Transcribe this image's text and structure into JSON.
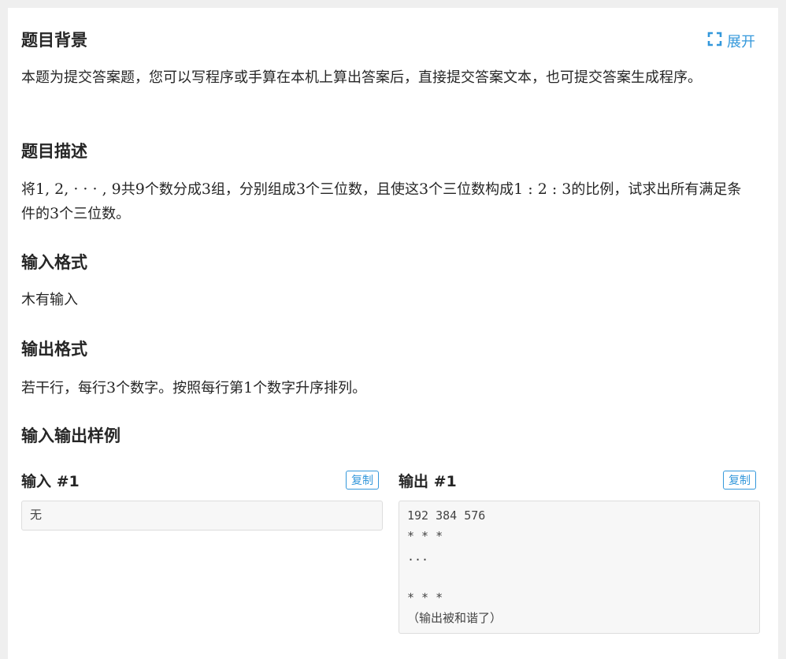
{
  "header": {
    "expand_label": "展开"
  },
  "sections": {
    "background": {
      "title": "题目背景",
      "text": "本题为提交答案题，您可以写程序或手算在本机上算出答案后，直接提交答案文本，也可提交答案生成程序。"
    },
    "description": {
      "title": "题目描述",
      "text_1": "将",
      "math_1": "1, 2, · · · , 9",
      "text_2": "共",
      "math_2": "9",
      "text_3": "个数分成",
      "math_3": "3",
      "text_4": "组，分别组成",
      "math_4": "3",
      "text_5": "个三位数，且使这",
      "math_5": "3",
      "text_6": "个三位数构成",
      "math_6": "1 : 2 : 3",
      "text_7": "的比例，试求出所有满足条件的",
      "math_7": "3",
      "text_8": "个三位数。"
    },
    "input_format": {
      "title": "输入格式",
      "text": "木有输入"
    },
    "output_format": {
      "title": "输出格式",
      "text_1": "若干行，每行",
      "math_1": "3",
      "text_2": "个数字。按照每行第",
      "math_2": "1",
      "text_3": "个数字升序排列。"
    },
    "samples": {
      "title": "输入输出样例",
      "input_title": "输入 #1",
      "output_title": "输出 #1",
      "copy_label": "复制",
      "input_content": "无",
      "output_content": "192 384 576\n* * *\n...\n\n* * *\n（输出被和谐了）"
    }
  },
  "colors": {
    "accent": "#3498db",
    "page_bg": "#efefef",
    "card_bg": "#ffffff",
    "code_bg": "#f7f7f7"
  }
}
